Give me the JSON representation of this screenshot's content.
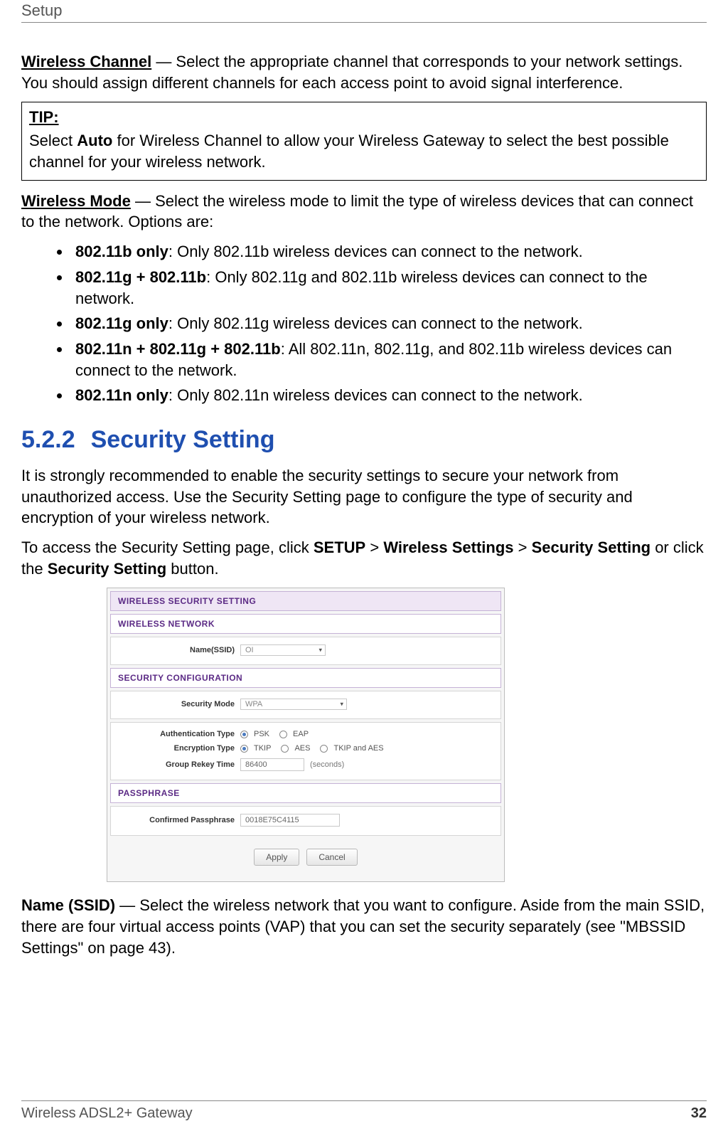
{
  "chapter": "Setup",
  "wireless_channel": {
    "term": "Wireless Channel",
    "desc": " — Select the appropriate channel that corresponds to your network settings. You should assign different channels for each access point to avoid signal interference."
  },
  "tip": {
    "label": "TIP:",
    "pre": "Select ",
    "bold": "Auto",
    "post": " for Wireless Channel to allow your Wireless Gateway to select the best possible channel for your wireless network."
  },
  "wireless_mode": {
    "term": "Wireless Mode",
    "desc": " — Select the wireless mode to limit the type of wireless devices that can connect to the network. Options are:",
    "items": [
      {
        "b": "802.11b only",
        "t": ": Only 802.11b wireless devices can connect to the network."
      },
      {
        "b": "802.11g + 802.11b",
        "t": ": Only 802.11g and 802.11b wireless devices can connect to the network."
      },
      {
        "b": "802.11g only",
        "t": ": Only 802.11g wireless devices can connect to the network."
      },
      {
        "b": "802.11n + 802.11g + 802.11b",
        "t": ": All 802.11n, 802.11g, and 802.11b wireless devices can connect to the network."
      },
      {
        "b": "802.11n only",
        "t": ": Only 802.11n wireless devices can connect to the network."
      }
    ]
  },
  "section": {
    "num": "5.2.2",
    "title": "Security Setting"
  },
  "sec_para1": "It is strongly recommended to enable the security settings to secure your network from unauthorized access. Use the Security Setting page to configure the type of security and encryption of your wireless network.",
  "sec_para2": {
    "pre": "To access the Security Setting page, click ",
    "b1": "SETUP",
    "m1": " > ",
    "b2": "Wireless Settings",
    "m2": " > ",
    "b3": "Security Setting",
    "m3": " or click the ",
    "b4": "Security Setting",
    "post": " button."
  },
  "shot": {
    "title": "WIRELESS SECURITY SETTING",
    "wnet": "WIRELESS NETWORK",
    "name_label": "Name(SSID)",
    "name_value": "OI",
    "secconf": "SECURITY CONFIGURATION",
    "secmode_label": "Security Mode",
    "secmode_value": "WPA",
    "auth_label": "Authentication Type",
    "auth_opts": [
      "PSK",
      "EAP"
    ],
    "enc_label": "Encryption Type",
    "enc_opts": [
      "TKIP",
      "AES",
      "TKIP and AES"
    ],
    "grk_label": "Group Rekey Time",
    "grk_value": "86400",
    "grk_unit": "(seconds)",
    "pass_hdr": "PASSPHRASE",
    "pass_label": "Confirmed Passphrase",
    "pass_value": "0018E75C4115",
    "apply": "Apply",
    "cancel": "Cancel"
  },
  "ssid_para": {
    "term": "Name (SSID)",
    "desc": " — Select the wireless network that you want to configure. Aside from the main SSID, there are four virtual access points (VAP) that you can set the security separately (see \"MBSSID Settings\" on page 43)."
  },
  "footer": {
    "product": "Wireless ADSL2+ Gateway",
    "page": "32"
  }
}
